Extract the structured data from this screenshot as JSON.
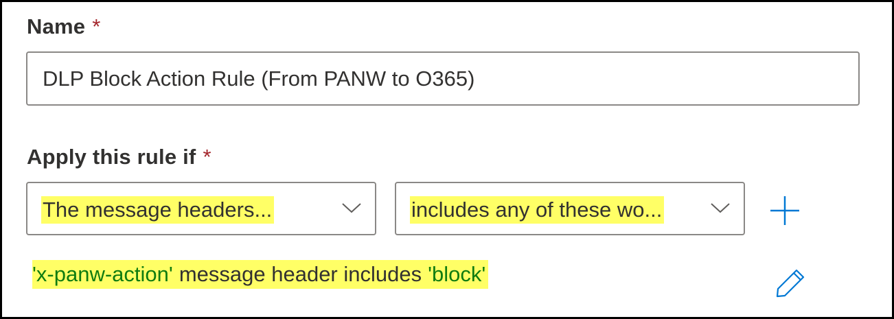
{
  "name_field": {
    "label": "Name",
    "required_marker": "*",
    "value": "DLP Block Action Rule (From PANW to O365)"
  },
  "apply_rule": {
    "label": "Apply this rule if",
    "required_marker": "*",
    "condition_dropdown": {
      "selected": "The message headers...",
      "icon": "chevron-down-icon"
    },
    "operator_dropdown": {
      "selected": "includes any of these wo...",
      "icon": "chevron-down-icon"
    },
    "add_icon": "plus-icon",
    "summary": {
      "header_value": "'x-panw-action'",
      "middle_text": "message header includes",
      "match_value": "'block'"
    },
    "edit_icon": "pencil-icon"
  },
  "colors": {
    "highlight": "#ffff66",
    "accent": "#0078d4",
    "required": "#a4262c",
    "value_green": "#107c10",
    "border": "#8a8886",
    "text": "#323130"
  }
}
